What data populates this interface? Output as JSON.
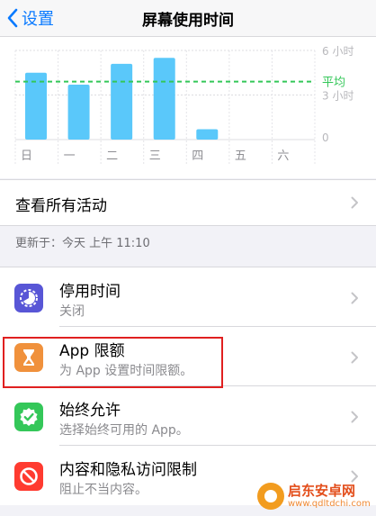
{
  "nav": {
    "back_label": "设置",
    "title": "屏幕使用时间"
  },
  "chart_data": {
    "type": "bar",
    "categories": [
      "日",
      "一",
      "二",
      "三",
      "四",
      "五",
      "六"
    ],
    "values": [
      4.5,
      3.7,
      5.1,
      5.5,
      0.7,
      0,
      0
    ],
    "y_ticks": [
      {
        "label": "6 小时",
        "value": 6
      },
      {
        "label": "3 小时",
        "value": 3
      },
      {
        "label": "0",
        "value": 0
      }
    ],
    "average": {
      "label": "平均",
      "value": 3.9
    },
    "ylim": [
      0,
      6
    ],
    "bar_color": "#5ac8fa",
    "average_color": "#34c759"
  },
  "activity": {
    "label": "查看所有活动"
  },
  "updated": {
    "text": "更新于：今天 上午 11:10"
  },
  "items": [
    {
      "title": "停用时间",
      "subtitle": "关闭",
      "icon": "downtime-icon",
      "color": "#5856d6"
    },
    {
      "title": "App 限额",
      "subtitle": "为 App 设置时间限额。",
      "icon": "hourglass-icon",
      "color": "#f0913c"
    },
    {
      "title": "始终允许",
      "subtitle": "选择始终可用的 App。",
      "icon": "checkmark-badge-icon",
      "color": "#34c759"
    },
    {
      "title": "内容和隐私访问限制",
      "subtitle": "阻止不当内容。",
      "icon": "restriction-icon",
      "color": "#ff3b30"
    }
  ],
  "watermark": {
    "name": "启东安卓网",
    "url": "www.qdltdchi.com"
  }
}
